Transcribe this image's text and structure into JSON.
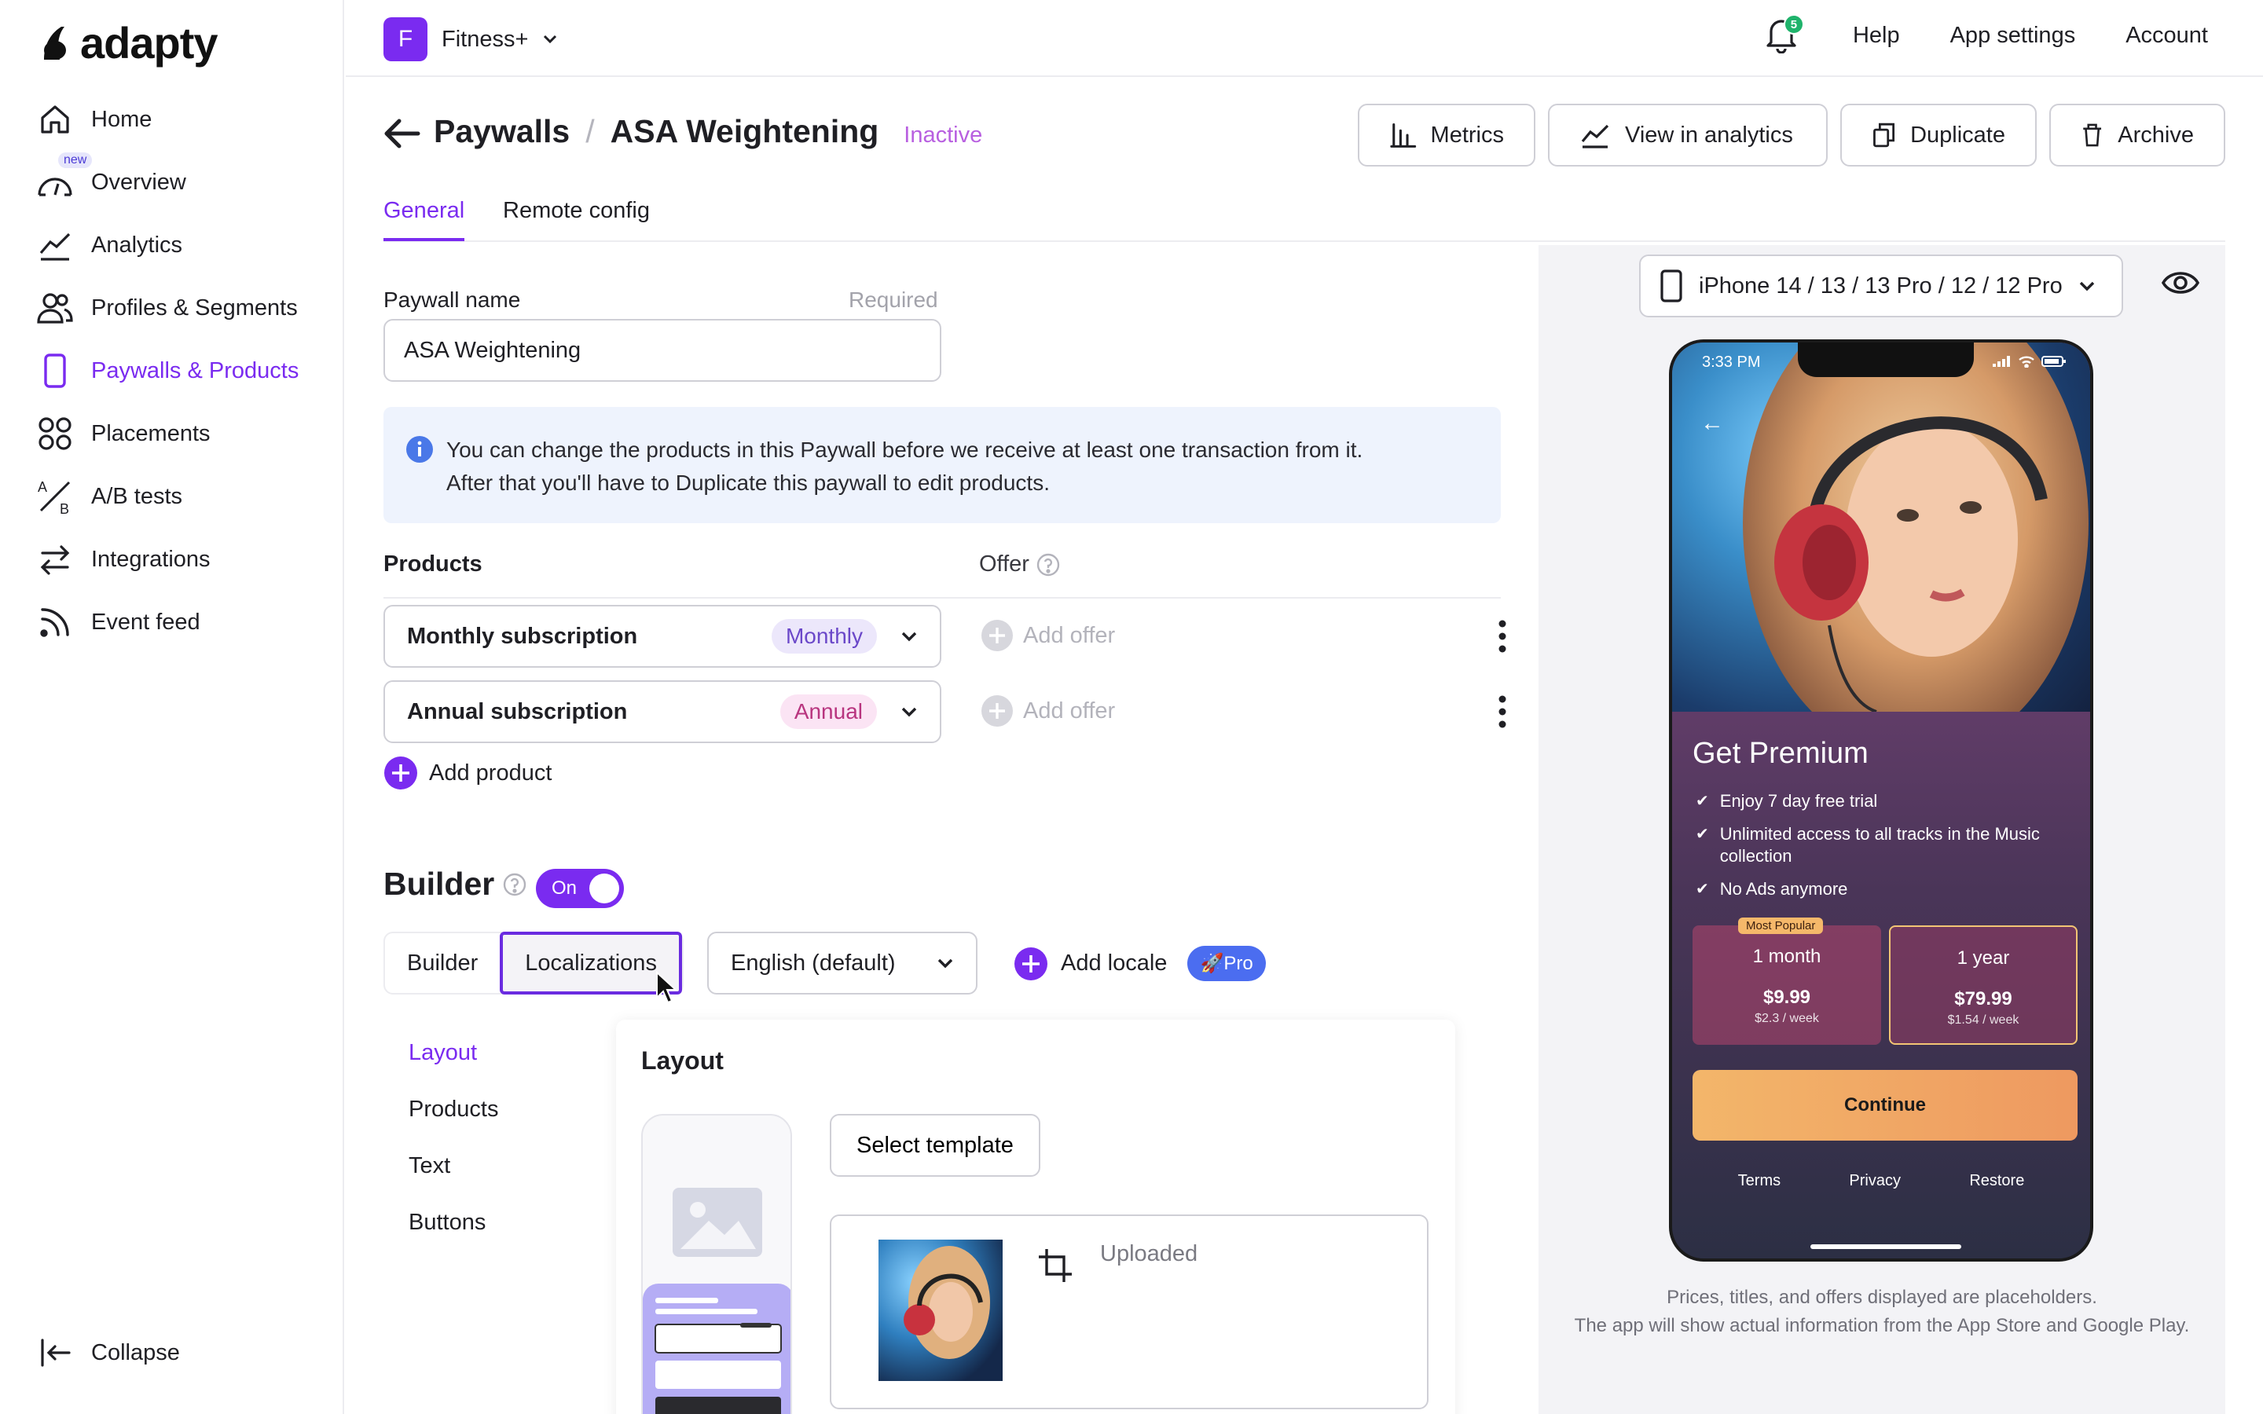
{
  "brand": {
    "name": "adapty"
  },
  "sidebar": {
    "items": [
      {
        "label": "Home",
        "icon": "home-icon"
      },
      {
        "label": "Overview",
        "icon": "gauge-icon",
        "badge": "new"
      },
      {
        "label": "Analytics",
        "icon": "chart-line-icon"
      },
      {
        "label": "Profiles & Segments",
        "icon": "users-icon"
      },
      {
        "label": "Paywalls & Products",
        "icon": "phone-icon",
        "active": true
      },
      {
        "label": "Placements",
        "icon": "grid-icon"
      },
      {
        "label": "A/B tests",
        "icon": "ab-icon"
      },
      {
        "label": "Integrations",
        "icon": "arrows-icon"
      },
      {
        "label": "Event feed",
        "icon": "feed-icon"
      }
    ],
    "collapse_label": "Collapse"
  },
  "topbar": {
    "app_initial": "F",
    "app_name": "Fitness+",
    "notification_count": "5",
    "help": "Help",
    "app_settings": "App settings",
    "account": "Account"
  },
  "header": {
    "crumb_root": "Paywalls",
    "separator": "/",
    "title": "ASA Weightening",
    "status": "Inactive",
    "actions": {
      "metrics": "Metrics",
      "analytics": "View in analytics",
      "duplicate": "Duplicate",
      "archive": "Archive"
    }
  },
  "tabs": {
    "general": "General",
    "remote_config": "Remote config"
  },
  "form": {
    "name_label": "Paywall name",
    "name_required": "Required",
    "name_value": "ASA Weightening",
    "info_line1": "You can change the products in this Paywall before we receive at least one transaction from it.",
    "info_line2": "After that you'll have to Duplicate this paywall to edit products.",
    "products_header": "Products",
    "offer_header": "Offer",
    "products": [
      {
        "name": "Monthly subscription",
        "period": "Monthly",
        "offer": "Add offer"
      },
      {
        "name": "Annual subscription",
        "period": "Annual",
        "offer": "Add offer"
      }
    ],
    "add_product": "Add product"
  },
  "builder": {
    "title": "Builder",
    "toggle": "On",
    "seg_builder": "Builder",
    "seg_localizations": "Localizations",
    "language": "English (default)",
    "add_locale": "Add locale",
    "pro": "Pro",
    "menu": [
      "Layout",
      "Products",
      "Text",
      "Buttons"
    ],
    "layout_title": "Layout",
    "select_template": "Select template",
    "uploaded": "Uploaded"
  },
  "preview": {
    "device": "iPhone 14 / 13 / 13 Pro / 12 / 12 Pro",
    "time": "3:33 PM",
    "headline": "Get Premium",
    "features": [
      "Enjoy 7 day free trial",
      "Unlimited access to all tracks in the Music collection",
      "No Ads anymore"
    ],
    "plans": [
      {
        "badge": "Most Popular",
        "period": "1 month",
        "price": "$9.99",
        "per_week": "$2.3 / week"
      },
      {
        "period": "1 year",
        "price": "$79.99",
        "per_week": "$1.54 / week"
      }
    ],
    "continue": "Continue",
    "links": [
      "Terms",
      "Privacy",
      "Restore"
    ],
    "note_line1": "Prices, titles, and offers displayed are placeholders.",
    "note_line2": "The app will show actual information from the App Store and Google Play."
  }
}
